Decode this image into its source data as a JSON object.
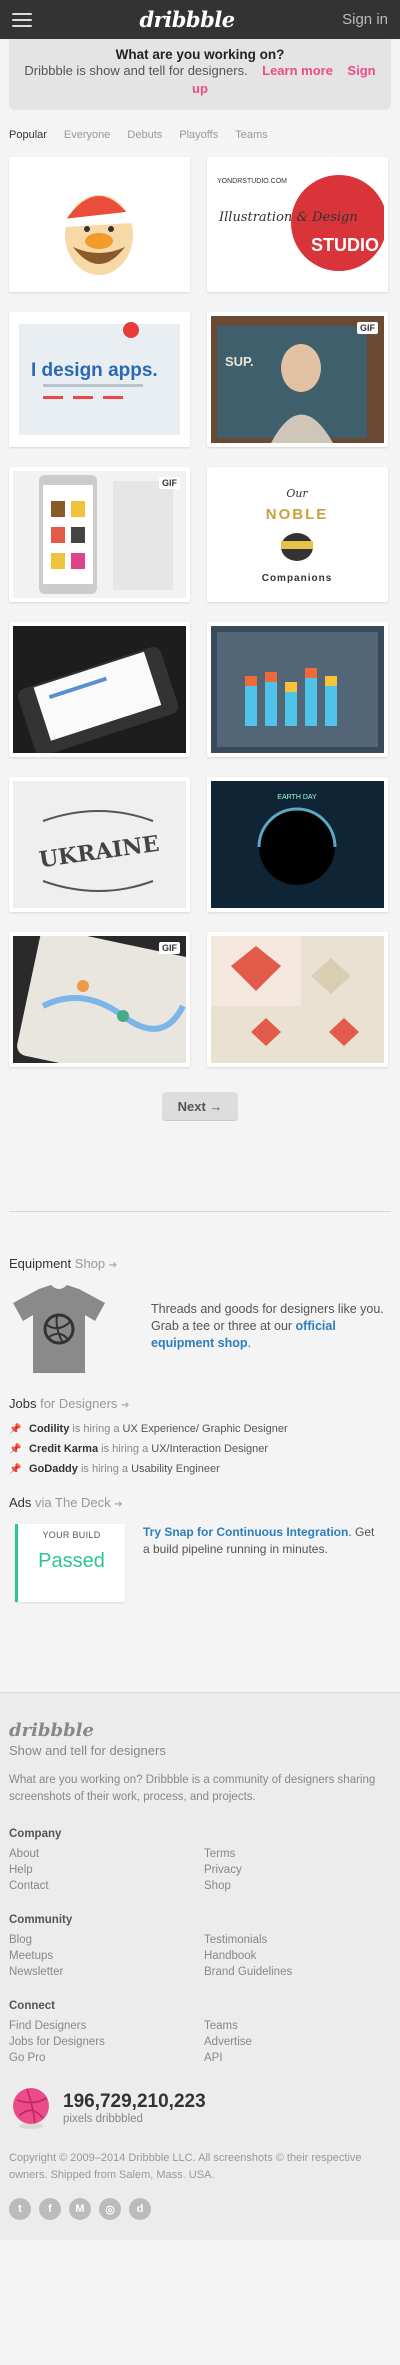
{
  "header": {
    "logo": "dribbble",
    "signin": "Sign in"
  },
  "intro": {
    "question": "What are you working on?",
    "description": "Dribbble is show and tell for designers.",
    "learn_more": "Learn more",
    "sign_up": "Sign up"
  },
  "tabs": [
    "Popular",
    "Everyone",
    "Debuts",
    "Playoffs",
    "Teams"
  ],
  "shots": [
    {
      "gif": ""
    },
    {
      "gif": ""
    },
    {
      "gif": ""
    },
    {
      "gif": "GIF"
    },
    {
      "gif": "GIF"
    },
    {
      "gif": ""
    },
    {
      "gif": ""
    },
    {
      "gif": ""
    },
    {
      "gif": ""
    },
    {
      "gif": ""
    },
    {
      "gif": "GIF"
    },
    {
      "gif": ""
    }
  ],
  "shot_texts": {
    "design_apps": "I design apps.",
    "yondr_line": "YONDRSTUDIO.COM",
    "yondr_sub": "Illustration & Design",
    "yondr_studio": "STUDIO",
    "sup": "SUP.",
    "our": "Our",
    "noble": "NOBLE",
    "companions": "Companions",
    "ukraine": "UKRAINE",
    "earth_day": "EARTH DAY"
  },
  "pagination": {
    "next": "Next →"
  },
  "equipment": {
    "title": "Equipment",
    "title_link": "Shop",
    "text": "Threads and goods for designers like you. Grab a tee or three at our",
    "link": "official equipment shop",
    "suffix": "."
  },
  "jobs": {
    "title": "Jobs",
    "title_link": "for Designers",
    "items": [
      {
        "company": "Codility",
        "hiring": "is hiring a",
        "role": "UX Experience/ Graphic Designer"
      },
      {
        "company": "Credit Karma",
        "hiring": "is hiring a",
        "role": "UX/Interaction Designer"
      },
      {
        "company": "GoDaddy",
        "hiring": "is hiring a",
        "role": "Usability Engineer"
      }
    ]
  },
  "ads": {
    "title": "Ads",
    "title_link": "via The Deck",
    "card_small": "YOUR BUILD",
    "card_status": "Passed",
    "link": "Try Snap for Continuous Integration",
    "text": ". Get a build pipeline running in minutes."
  },
  "footer": {
    "logo": "dribbble",
    "tagline": "Show and tell for designers",
    "description": "What are you working on? Dribbble is a community of designers sharing screenshots of their work, process, and projects.",
    "company": {
      "title": "Company",
      "links": [
        "About",
        "Terms",
        "Help",
        "Privacy",
        "Contact",
        "Shop"
      ]
    },
    "community": {
      "title": "Community",
      "links": [
        "Blog",
        "Testimonials",
        "Meetups",
        "Handbook",
        "Newsletter",
        "Brand Guidelines"
      ]
    },
    "connect": {
      "title": "Connect",
      "links": [
        "Find Designers",
        "Teams",
        "Jobs for Designers",
        "Advertise",
        "Go Pro",
        "API"
      ]
    },
    "stat_number": "196,729,210,223",
    "stat_label": "pixels dribbbled",
    "copyright": "Copyright © 2009–2014 Dribbble LLC. All screenshots © their respective owners. Shipped from Salem, Mass. USA.",
    "social": [
      "t",
      "f",
      "M",
      "◎",
      "d"
    ]
  },
  "colors": {
    "brand_pink": "#ea4c89",
    "link_blue": "#2d7ebc",
    "ad_green": "#2cc693"
  }
}
